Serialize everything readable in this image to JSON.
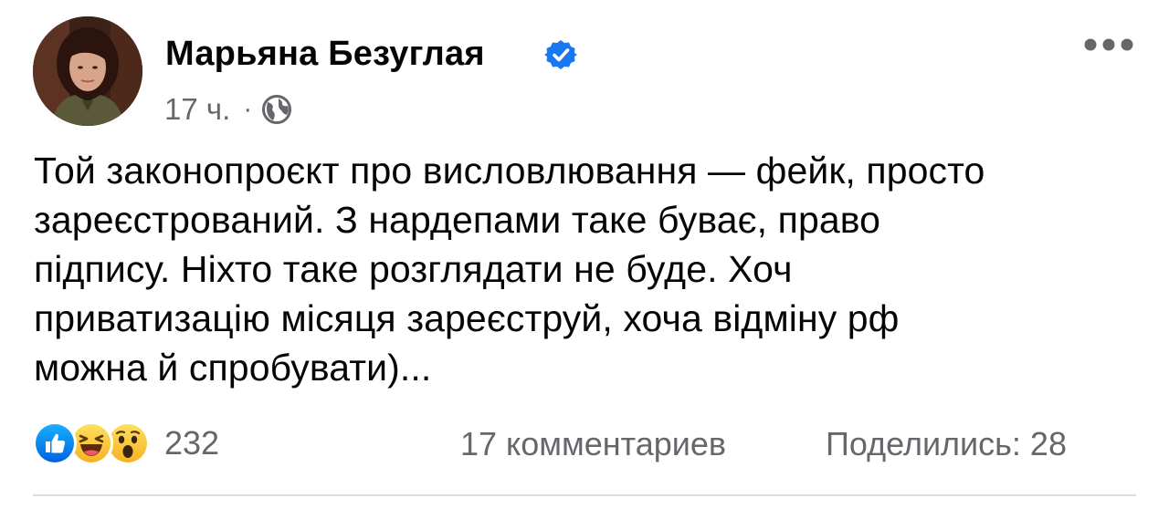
{
  "post": {
    "author": "Марьяна Безуглая",
    "verified": true,
    "timestamp": "17 ч.",
    "separator": "·",
    "audience_icon": "globe-icon",
    "more_icon": "more-options-icon",
    "text_lines": [
      "Той законопроєкт про висловлювання — фейк, просто",
      "зареєстрований. З нардепами таке буває, право",
      "підпису. Ніхто таке розглядати не буде. Хоч",
      "приватизацію місяця зареєструй, хоча відміну рф",
      "можна й спробувати)..."
    ],
    "reactions": {
      "icons": [
        "like-icon",
        "haha-icon",
        "wow-icon"
      ],
      "count": "232"
    },
    "comments_label": "17 комментариев",
    "shares_label": "Поделились: 28"
  },
  "colors": {
    "text": "#050505",
    "secondary": "#65676b",
    "accent_blue": "#1877f2",
    "divider": "#dadde1"
  }
}
